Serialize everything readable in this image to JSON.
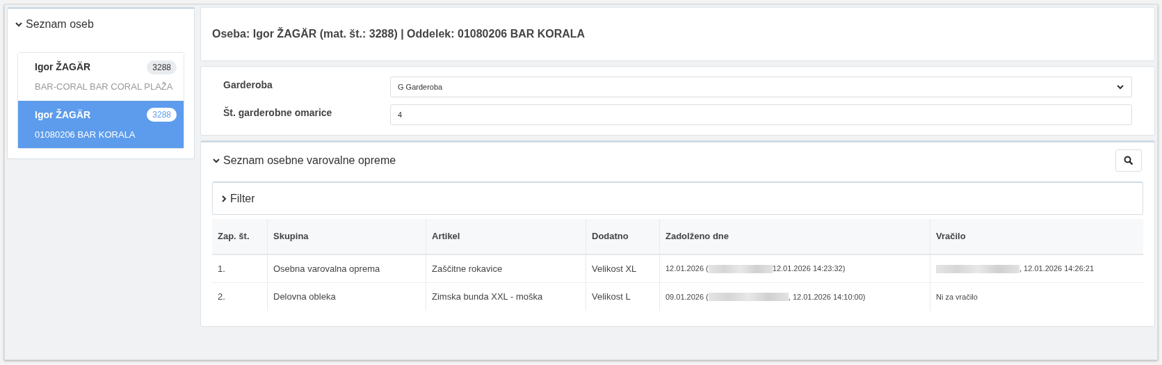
{
  "people_panel": {
    "title": "Seznam oseb",
    "expanded": true,
    "items": [
      {
        "name": "Igor ŽAGÄR",
        "badge": "3288",
        "unit": "BAR-CORAL BAR CORAL PLAŽA",
        "selected": false
      },
      {
        "name": "Igor ŽAGÄR",
        "badge": "3288",
        "unit": "01080206 BAR KORALA",
        "selected": true
      }
    ]
  },
  "header": {
    "title": "Oseba: Igor ŽAGÄR (mat. št.: 3288) | Oddelek: 01080206 BAR KORALA"
  },
  "form": {
    "fields": [
      {
        "kind": "select",
        "label": "Garderoba",
        "value": "G Garderoba"
      },
      {
        "kind": "input",
        "label": "Št. garderobne omarice",
        "value": "4"
      }
    ]
  },
  "equipment": {
    "title": "Seznam osebne varovalne opreme",
    "expanded": true,
    "filter": {
      "label": "Filter",
      "expanded": false
    },
    "table": {
      "columns": [
        "Zap. št.",
        "Skupina",
        "Artikel",
        "Dodatno",
        "Zadolženo dne",
        "Vračilo"
      ],
      "rows": [
        {
          "cells": [
            "1.",
            "Osebna varovalna oprema",
            "Zaščitne rokavice",
            "Velikost XL"
          ],
          "issued": {
            "before": "12.01.2026 (",
            "redacted": true,
            "after": "12.01.2026 14:23:32)"
          },
          "returned": {
            "redacted": true,
            "after": ", 12.01.2026 14:26:21"
          }
        },
        {
          "cells": [
            "2.",
            "Delovna obleka",
            "Zimska bunda XXL - moška",
            "Velikost L"
          ],
          "issued": {
            "before": "09.01.2026 (",
            "redacted": true,
            "after": ", 12.01.2026 14:10:00)"
          },
          "returned": {
            "before": "Ni za vračilo",
            "redacted": false
          }
        }
      ]
    }
  }
}
